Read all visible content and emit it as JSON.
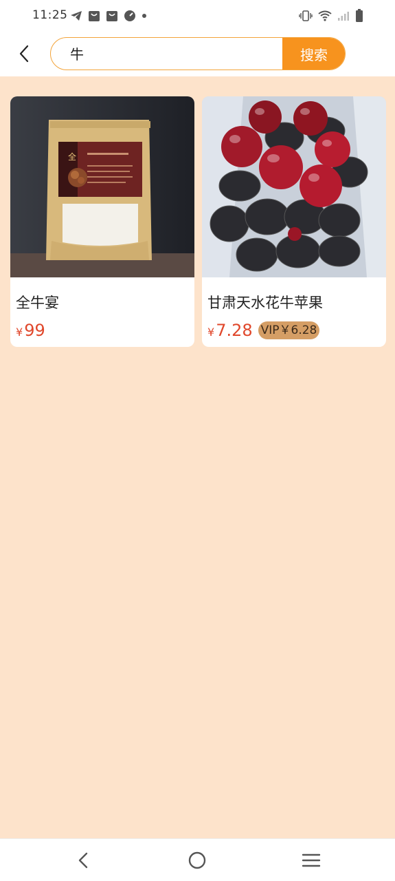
{
  "status_bar": {
    "time": "11:25"
  },
  "search": {
    "query": "牛",
    "button_label": "搜索"
  },
  "products": [
    {
      "title": "全牛宴",
      "currency": "¥",
      "price": "99"
    },
    {
      "title": "甘肃天水花牛苹果",
      "currency": "¥",
      "price": "7.28",
      "vip_label": "VIP￥6.28"
    }
  ],
  "colors": {
    "accent": "#f7931e",
    "background": "#fde3cb",
    "price": "#e0472b",
    "vip_badge": "#d59e65"
  }
}
